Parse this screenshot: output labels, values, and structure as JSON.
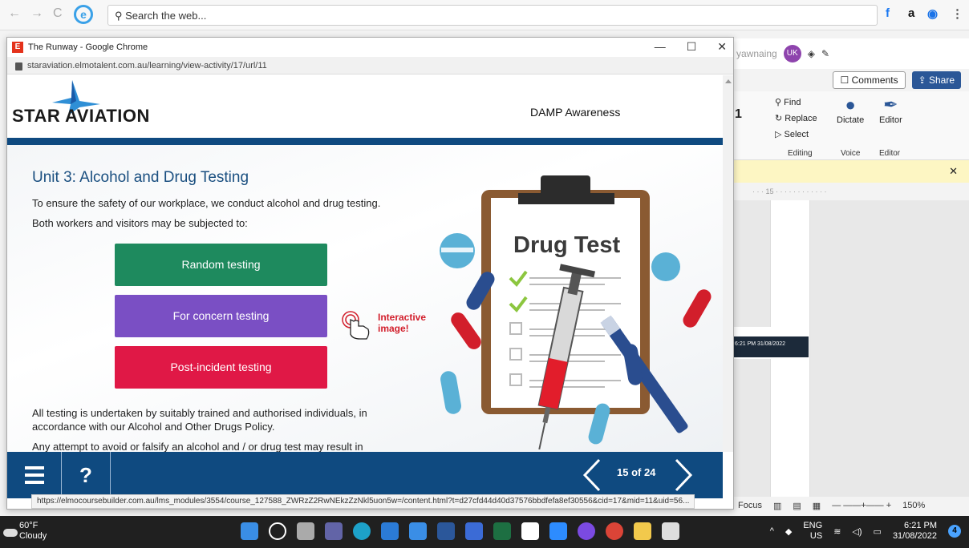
{
  "background_browser": {
    "search_placeholder": "Search the web..."
  },
  "word": {
    "username": "yawnaing",
    "user_initials": "UK",
    "comments_label": "Comments",
    "share_label": "Share",
    "find_label": "Find",
    "replace_label": "Replace",
    "select_label": "Select",
    "dictate_label": "Dictate",
    "editor_label": "Editor",
    "group_editing": "Editing",
    "group_voice": "Voice",
    "group_editor": "Editor",
    "ruler_text": "· · · 15 · · · · · · · · · · · ·",
    "focus_label": "Focus",
    "zoom": "150%",
    "font_size_fragment": "1"
  },
  "chrome": {
    "window_title": "The Runway - Google Chrome",
    "url": "staraviation.elmotalent.com.au/learning/view-activity/17/url/11",
    "status_url": "https://elmocoursebuilder.com.au/lms_modules/3554/course_127588_ZWRzZ2RwNEkzZzNkl5uon5w=/content.html?t=d27cfd44d40d37576bbdfefa8ef30556&cid=17&mid=11&uid=56..."
  },
  "course": {
    "logo_text": "STAR AVIATION",
    "course_name": "DAMP Awareness",
    "unit_title": "Unit 3: Alcohol and Drug Testing",
    "intro_1": "To ensure the safety of our workplace, we conduct alcohol and drug testing.",
    "intro_2": "Both workers and visitors may be subjected to:",
    "buttons": [
      {
        "label": "Random testing",
        "color": "#1e8a5e"
      },
      {
        "label": "For concern testing",
        "color": "#7a4fc4"
      },
      {
        "label": "Post-incident testing",
        "color": "#e01846"
      }
    ],
    "interactive_label": "Interactive image!",
    "clipboard_title": "Drug Test",
    "body_1": "All testing is undertaken by suitably trained and authorised individuals, in accordance with our Alcohol and Other Drugs Policy.",
    "body_2": "Any attempt to avoid or falsify an alcohol and / or drug test may result in",
    "pager": "15 of 24"
  },
  "taskbar": {
    "temperature": "60°F",
    "condition": "Cloudy",
    "lang_1": "ENG",
    "lang_2": "US",
    "time": "6:21 PM",
    "date": "31/08/2022",
    "notifications": "4"
  },
  "colors": {
    "brand_blue": "#0f4a80",
    "title_blue": "#1a4f80",
    "accent_red": "#d21e2b"
  }
}
